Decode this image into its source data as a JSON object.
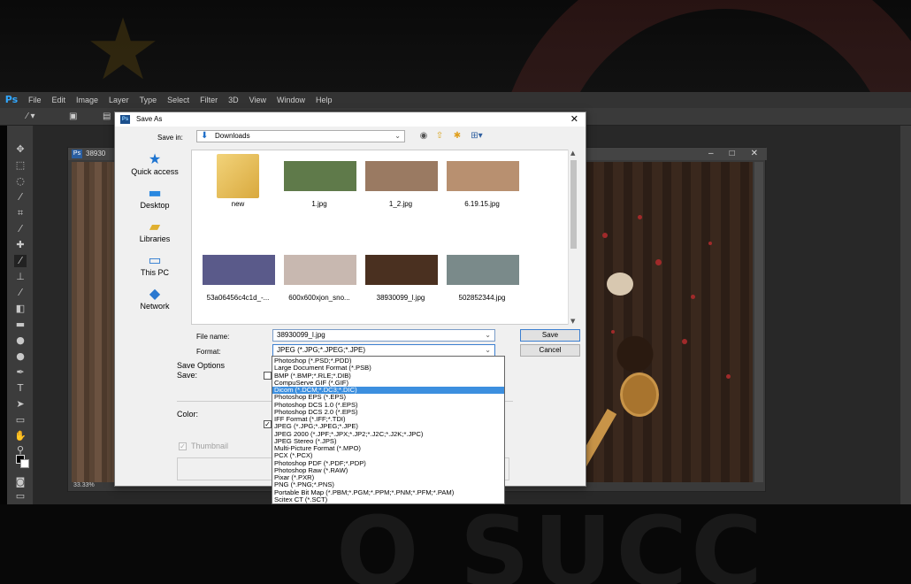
{
  "ps": {
    "logo": "Ps",
    "menu": [
      "File",
      "Edit",
      "Image",
      "Layer",
      "Type",
      "Select",
      "Filter",
      "3D",
      "View",
      "Window",
      "Help"
    ],
    "doc_tab": "38930",
    "zoom": "33.33%"
  },
  "dialog": {
    "title": "Save As",
    "save_in_label": "Save in:",
    "save_in_value": "Downloads",
    "sidebar": [
      {
        "label": "Quick access",
        "icon": "star-icon"
      },
      {
        "label": "Desktop",
        "icon": "desktop-icon"
      },
      {
        "label": "Libraries",
        "icon": "libraries-icon"
      },
      {
        "label": "This PC",
        "icon": "computer-icon"
      },
      {
        "label": "Network",
        "icon": "network-icon"
      }
    ],
    "files": [
      {
        "name": "new",
        "kind": "folder",
        "color": "#e8c45a"
      },
      {
        "name": "1.jpg",
        "kind": "image",
        "color": "#5f7a4a"
      },
      {
        "name": "1_2.jpg",
        "kind": "image",
        "color": "#9a7a62"
      },
      {
        "name": "6.19.15.jpg",
        "kind": "image",
        "color": "#b89070"
      },
      {
        "name": "53a06456c4c1d_-...",
        "kind": "image",
        "color": "#5a5a8a"
      },
      {
        "name": "600x600xjon_sno...",
        "kind": "image",
        "color": "#c8b8b0"
      },
      {
        "name": "38930099_l.jpg",
        "kind": "image",
        "color": "#4a3020"
      },
      {
        "name": "502852344.jpg",
        "kind": "image",
        "color": "#7a8a8a"
      }
    ],
    "file_name_label": "File name:",
    "file_name_value": "38930099_l.jpg",
    "format_label": "Format:",
    "format_value": "JPEG (*.JPG;*.JPEG;*.JPE)",
    "save_label": "Save",
    "cancel_label": "Cancel",
    "save_options_label": "Save Options",
    "save_label_sub": "Save:",
    "color_label": "Color:",
    "thumbnail_label": "Thumbnail"
  },
  "format_options": [
    "Photoshop (*.PSD;*.PDD)",
    "Large Document Format (*.PSB)",
    "BMP (*.BMP;*.RLE;*.DIB)",
    "CompuServe GIF (*.GIF)",
    "Dicom (*.DCM;*.DC3;*.DIC)",
    "Photoshop EPS (*.EPS)",
    "Photoshop DCS 1.0 (*.EPS)",
    "Photoshop DCS 2.0 (*.EPS)",
    "IFF Format (*.IFF;*.TDI)",
    "JPEG (*.JPG;*.JPEG;*.JPE)",
    "JPEG 2000 (*.JPF;*.JPX;*.JP2;*.J2C;*.J2K;*.JPC)",
    "JPEG Stereo (*.JPS)",
    "Multi-Picture Format (*.MPO)",
    "PCX (*.PCX)",
    "Photoshop PDF (*.PDF;*.PDP)",
    "Photoshop Raw (*.RAW)",
    "Pixar (*.PXR)",
    "PNG (*.PNG;*.PNS)",
    "Portable Bit Map (*.PBM;*.PGM;*.PPM;*.PNM;*.PFM;*.PAM)",
    "Scitex CT (*.SCT)"
  ],
  "format_selected_index": 4,
  "colors": {
    "ps_blue": "#31a8ff",
    "selection": "#3c8fdf",
    "folder_blue": "#1e6ec8"
  }
}
